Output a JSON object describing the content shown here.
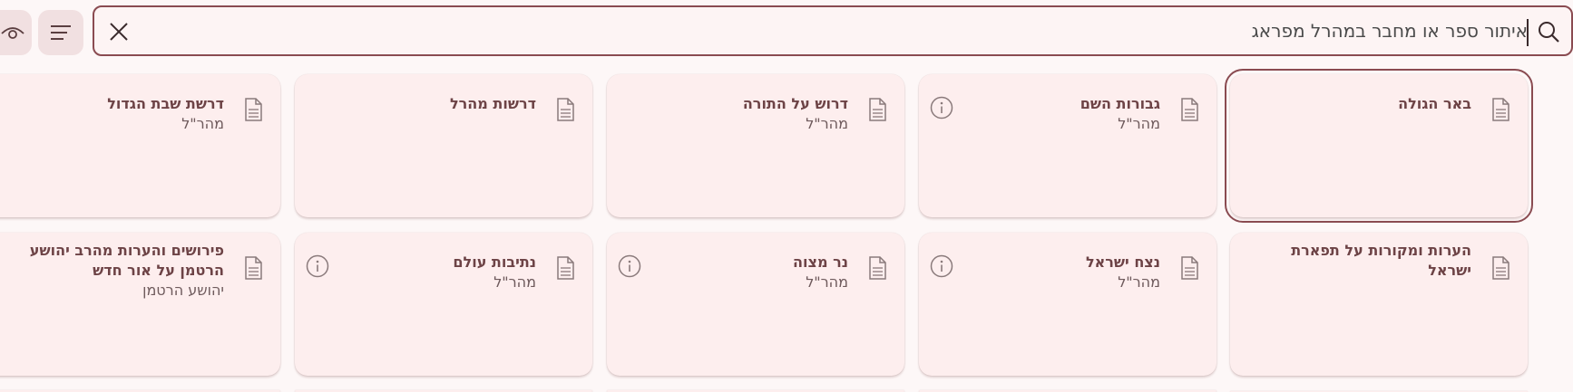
{
  "search": {
    "value": "איתור ספר או מחבר במהרל מפראג"
  },
  "toolbar": {
    "menu_icon": "menu-icon",
    "view_icon": "eye-icon"
  },
  "colors": {
    "accent": "#8a4b51",
    "card_bg": "#fdeeee",
    "page_bg": "#fdf7f7"
  },
  "cards": [
    {
      "title": "באר הגולה",
      "author": ""
    },
    {
      "title": "גבורות השם",
      "author": "מהר\"ל"
    },
    {
      "title": "דרוש על התורה",
      "author": "מהר\"ל"
    },
    {
      "title": "דרשות מהרל",
      "author": ""
    },
    {
      "title": "דרשת שבת הגדול",
      "author": "מהר\"ל"
    },
    {
      "title": "הערות ומקורות על תפארת ישראל",
      "author": ""
    },
    {
      "title": "נצח ישראל",
      "author": "מהר\"ל"
    },
    {
      "title": "נר מצוה",
      "author": "מהר\"ל"
    },
    {
      "title": "נתיבות עולם",
      "author": "מהר\"ל"
    },
    {
      "title": "פירושים והערות מהרב יהושע הרטמן על אור חדש",
      "author": "יהושע הרטמן"
    }
  ]
}
